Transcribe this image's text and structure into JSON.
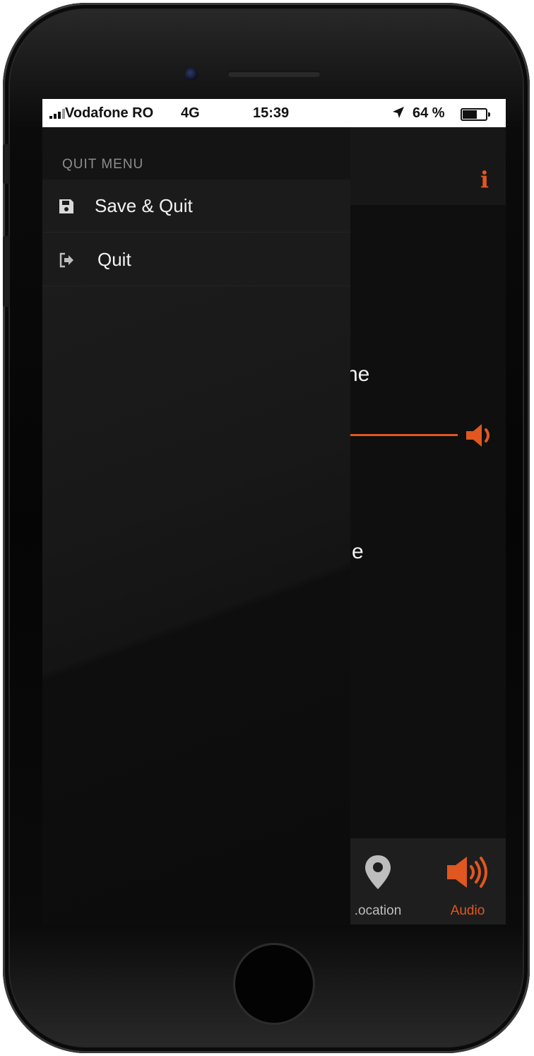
{
  "status_bar": {
    "carrier": "Vodafone RO",
    "network": "4G",
    "time": "15:39",
    "location_icon": "location-arrow-icon",
    "battery_percent": "64 %",
    "battery_level": 0.64
  },
  "header": {
    "info_label": "i"
  },
  "background_content": {
    "volume_label_fragment": "ne",
    "second_label_fragment": "e",
    "slider_value": 1.0
  },
  "quit_menu": {
    "title": "QUIT MENU",
    "items": [
      {
        "label": "Save & Quit",
        "icon": "floppy-disk-icon"
      },
      {
        "label": "Quit",
        "icon": "sign-out-icon"
      }
    ]
  },
  "tab_bar": {
    "tabs": [
      {
        "label": ".ocation",
        "icon": "map-marker-icon",
        "active": false
      },
      {
        "label": "Audio",
        "icon": "speaker-volume-icon",
        "active": true
      }
    ]
  },
  "colors": {
    "accent": "#e0571f",
    "background": "#0f0f0f",
    "menu_bg": "#1b1b1b"
  }
}
